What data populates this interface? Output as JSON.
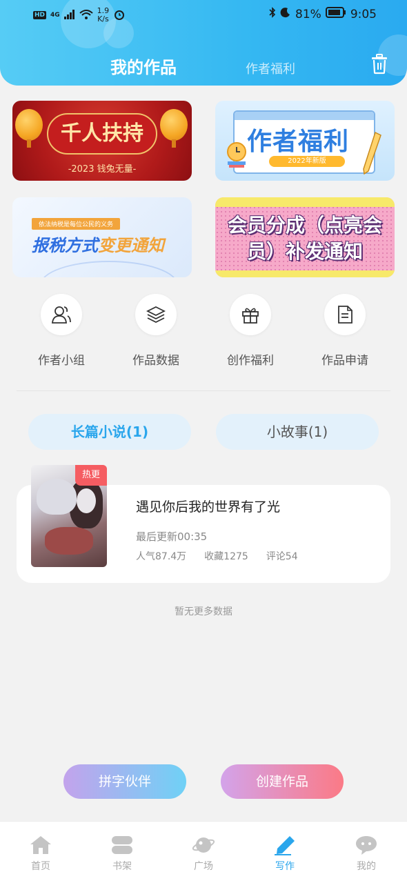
{
  "status_bar": {
    "left": [
      "HD",
      "4G"
    ],
    "speed_value": "1.9",
    "speed_unit": "K/s",
    "battery": "81%",
    "time": "9:05"
  },
  "header": {
    "tab_active": "我的作品",
    "tab_inactive": "作者福利",
    "trash_icon": "trash-icon"
  },
  "banners": [
    {
      "title": "千人扶持",
      "subtitle": "-2023 钱兔无量-"
    },
    {
      "title": "作者福利",
      "pill": "2022年新版"
    },
    {
      "small": "依法纳税是每位公民的义务",
      "title_part1": "报税方式",
      "title_part2": "变更通知"
    },
    {
      "line1": "会员分成（点亮会",
      "line2": "员）补发通知"
    }
  ],
  "quick_actions": [
    {
      "label": "作者小组",
      "icon": "author-group-icon"
    },
    {
      "label": "作品数据",
      "icon": "layers-icon"
    },
    {
      "label": "创作福利",
      "icon": "gift-icon"
    },
    {
      "label": "作品申请",
      "icon": "document-icon"
    }
  ],
  "category_tabs": {
    "active": "长篇小说(1)",
    "inactive": "小故事(1)"
  },
  "work": {
    "tag": "热更",
    "title": "遇见你后我的世界有了光",
    "update": "最后更新00:35",
    "popularity": "人气87.4万",
    "favorites": "收藏1275",
    "comments": "评论54"
  },
  "no_more_text": "暂无更多数据",
  "buttons": {
    "left": "拼字伙伴",
    "right": "创建作品"
  },
  "nav": [
    {
      "label": "首页",
      "icon": "home-icon"
    },
    {
      "label": "书架",
      "icon": "bookshelf-icon"
    },
    {
      "label": "广场",
      "icon": "planet-icon"
    },
    {
      "label": "写作",
      "icon": "pen-icon",
      "active": true
    },
    {
      "label": "我的",
      "icon": "chat-bubble-icon"
    }
  ],
  "colors": {
    "accent": "#2aa6ec",
    "header_start": "#56ccf5",
    "header_end": "#2aaaf0",
    "hot_tag": "#f55d62"
  }
}
